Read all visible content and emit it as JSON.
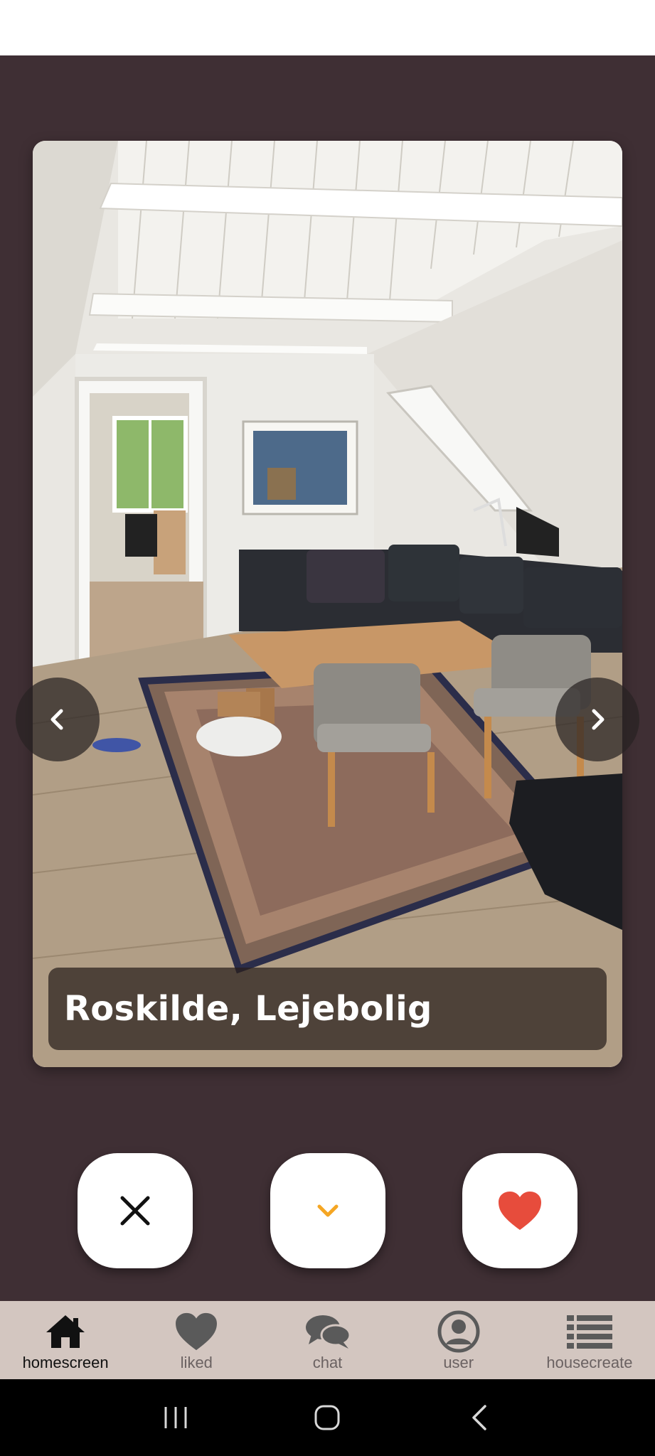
{
  "listing": {
    "caption": "Roskilde, Lejebolig",
    "photo": "living-room-photo"
  },
  "carousel": {
    "prev_icon": "chevron-left-icon",
    "next_icon": "chevron-right-icon"
  },
  "actions": {
    "dislike_icon": "close-icon",
    "skip_icon": "chevron-down-icon",
    "like_icon": "heart-icon",
    "skip_color": "#f5a623",
    "like_color": "#e74c3c"
  },
  "tabs": [
    {
      "label": "homescreen",
      "icon": "home-icon",
      "active": true
    },
    {
      "label": "liked",
      "icon": "heart-icon",
      "active": false
    },
    {
      "label": "chat",
      "icon": "chat-icon",
      "active": false
    },
    {
      "label": "user",
      "icon": "user-icon",
      "active": false
    },
    {
      "label": "housecreate",
      "icon": "list-icon",
      "active": false
    }
  ],
  "system_nav": [
    "recents-icon",
    "home-circle-icon",
    "back-icon"
  ],
  "colors": {
    "background": "#3f2f34",
    "tabbar": "#d3c6c0"
  }
}
